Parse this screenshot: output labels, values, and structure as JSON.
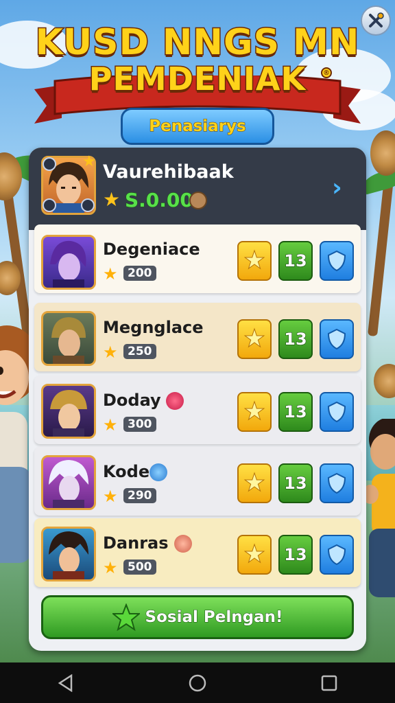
{
  "game": {
    "title_line1": "KUSD NNGS MN",
    "title_line2": "PEMDENIAK",
    "registered_mark": "®",
    "tab_label": "Penasiarys"
  },
  "player": {
    "name": "Vaurehibaak",
    "score": "S.0.00"
  },
  "rows": [
    {
      "name": "Degeniace",
      "score": "200",
      "action_count": "13"
    },
    {
      "name": "Megnglace",
      "score": "250",
      "action_count": "13"
    },
    {
      "name": "Doday",
      "score": "300",
      "action_count": "13"
    },
    {
      "name": "Kode",
      "score": "290",
      "action_count": "13"
    },
    {
      "name": "Danras",
      "score": "500",
      "action_count": "13"
    }
  ],
  "cta": {
    "label": "Sosial Pelngan!"
  },
  "icons": {
    "close": "close-tools-icon",
    "star": "star-icon",
    "shield": "shield-icon",
    "next": "chevron-right-icon",
    "nav_back": "back-icon",
    "nav_home": "home-icon",
    "nav_recent": "recents-icon"
  },
  "colors": {
    "title_yellow": "#ffd21a",
    "ribbon_red": "#c8281e",
    "panel_header": "#343b48",
    "score_green": "#58e04a",
    "cta_green": "#2f9a22",
    "action_blue": "#1f7ee0",
    "action_yellow": "#f2a80c"
  }
}
